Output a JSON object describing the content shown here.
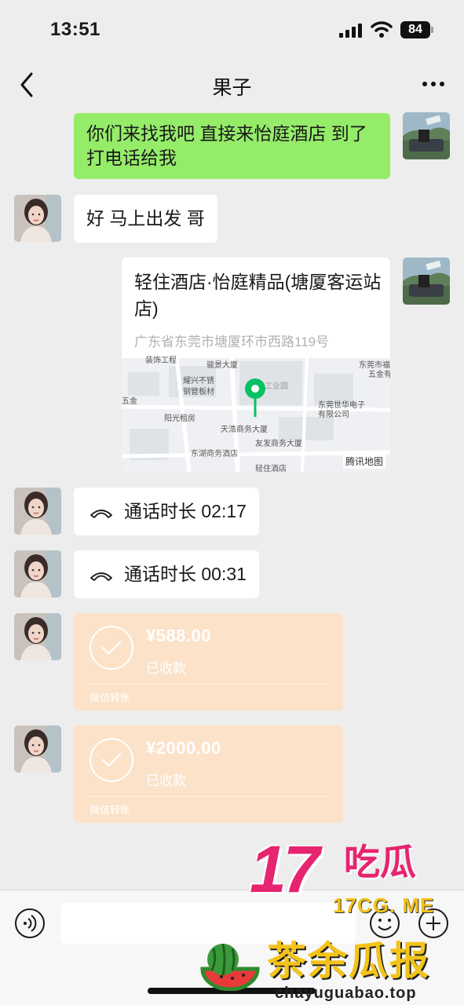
{
  "status_bar": {
    "time": "13:51",
    "battery": "84"
  },
  "header": {
    "title": "果子"
  },
  "messages": {
    "m1": {
      "text": "你们来找我吧 直接来怡庭酒店 到了打电话给我"
    },
    "m2": {
      "text": "好 马上出发 哥"
    },
    "location": {
      "name": "轻住酒店·怡庭精品(塘厦客运站店)",
      "address": "广东省东莞市塘厦环市西路119号",
      "map_labels": [
        "装饰工程",
        "骏景大厦",
        "东莞市福",
        "五金有",
        "耀兴不锈",
        "钢管板材",
        "工业园",
        "五金",
        "阳光租房",
        "东莞世华电子",
        "有限公司",
        "天浩商务大厦",
        "友发商务大厦",
        "东湖商务酒店",
        "轻住酒店"
      ],
      "map_brand": "腾讯地图"
    },
    "call1": {
      "text": "通话时长 02:17"
    },
    "call2": {
      "text": "通话时长 00:31"
    },
    "transfer1": {
      "amount": "¥588.00",
      "status": "已收款",
      "footer": "微信转账"
    },
    "transfer2": {
      "amount": "¥2000.00",
      "status": "已收款",
      "footer": "微信转账"
    }
  },
  "input": {
    "placeholder": ""
  },
  "watermark": {
    "big": "17",
    "cn": "吃瓜",
    "domain1": "17CG. ME",
    "cn2": "茶余瓜报",
    "domain2": "chayuguabao.top"
  },
  "colors": {
    "background": "#ededed",
    "sent_bubble": "#95ec69",
    "received_bubble": "#ffffff",
    "transfer": "#fbe2c8",
    "map_pin": "#07c160",
    "watermark_pink": "#e6246f",
    "watermark_yellow": "#f4c31a"
  },
  "icons": [
    "back-icon",
    "more-icon",
    "phone-icon",
    "check-icon",
    "voice-icon",
    "emoji-icon",
    "plus-icon",
    "map-pin-icon",
    "watermelon-logo"
  ]
}
